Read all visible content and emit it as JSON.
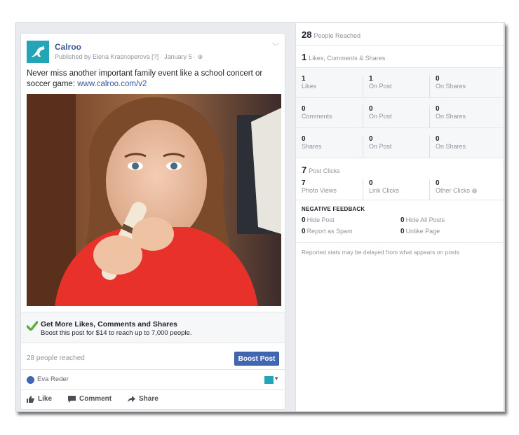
{
  "post": {
    "page_name": "Calroo",
    "meta": "Published by Elena Krasnoperova [?] · January 5 · ",
    "text": "Never miss another important family event like a school concert or soccer game: ",
    "link": "www.calroo.com/v2",
    "boost": {
      "title": "Get More Likes, Comments and Shares",
      "subtitle": "Boost this post for $14 to reach up to 7,000 people."
    },
    "reached": "28 people reached",
    "boost_button": "Boost Post",
    "commenter": "Eva Reder",
    "actions": {
      "like": "Like",
      "comment": "Comment",
      "share": "Share"
    }
  },
  "stats": {
    "reach": {
      "value": "28",
      "label": "People Reached"
    },
    "engagement": {
      "value": "1",
      "label": "Likes, Comments & Shares"
    },
    "rows": [
      [
        {
          "value": "1",
          "label": "Likes"
        },
        {
          "value": "1",
          "label": "On Post"
        },
        {
          "value": "0",
          "label": "On Shares"
        }
      ],
      [
        {
          "value": "0",
          "label": "Comments"
        },
        {
          "value": "0",
          "label": "On Post"
        },
        {
          "value": "0",
          "label": "On Shares"
        }
      ],
      [
        {
          "value": "0",
          "label": "Shares"
        },
        {
          "value": "0",
          "label": "On Post"
        },
        {
          "value": "0",
          "label": "On Shares"
        }
      ]
    ],
    "clicks": {
      "value": "7",
      "label": "Post Clicks"
    },
    "click_rows": [
      {
        "value": "7",
        "label": "Photo Views"
      },
      {
        "value": "0",
        "label": "Link Clicks"
      },
      {
        "value": "0",
        "label": "Other Clicks"
      }
    ],
    "negative": {
      "title": "NEGATIVE FEEDBACK",
      "items": [
        {
          "value": "0",
          "label": "Hide Post"
        },
        {
          "value": "0",
          "label": "Hide All Posts"
        },
        {
          "value": "0",
          "label": "Report as Spam"
        },
        {
          "value": "0",
          "label": "Unlike Page"
        }
      ]
    },
    "disclaimer": "Reported stats may be delayed from what appears on posts"
  },
  "colors": {
    "brand": "#23a5b7",
    "link": "#365899",
    "boost_button": "#4267b2",
    "check": "#5fad3a"
  },
  "icons": [
    "kangaroo-logo-icon",
    "chevron-down-icon",
    "globe-icon",
    "check-icon",
    "like-icon",
    "comment-icon",
    "share-icon",
    "info-icon"
  ]
}
